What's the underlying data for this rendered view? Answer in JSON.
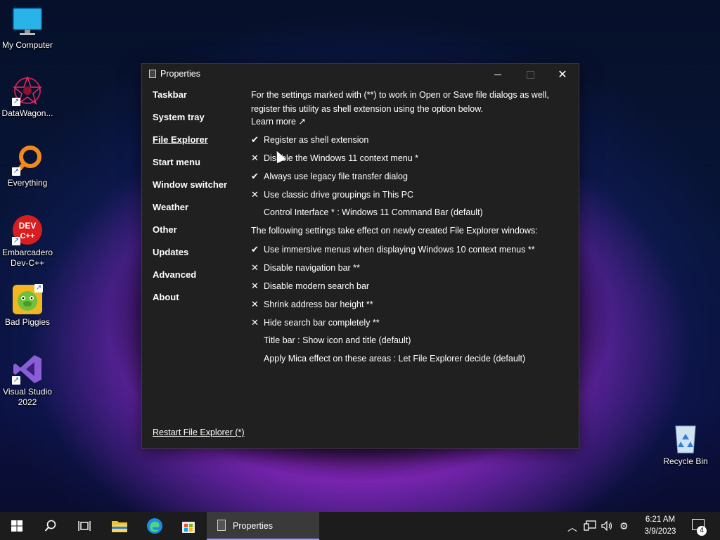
{
  "desktop": {
    "icons": [
      {
        "label": "My Computer"
      },
      {
        "label": "DataWagon..."
      },
      {
        "label": "Everything"
      },
      {
        "label": "Embarcadero Dev-C++"
      },
      {
        "label": "Bad Piggies"
      },
      {
        "label": "Visual Studio 2022"
      },
      {
        "label": "Recycle Bin"
      }
    ]
  },
  "window": {
    "title": "Properties",
    "nav": [
      "Taskbar",
      "System tray",
      "File Explorer",
      "Start menu",
      "Window switcher",
      "Weather",
      "Other",
      "Updates",
      "Advanced",
      "About"
    ],
    "active_nav": "File Explorer",
    "intro": "For the settings marked with (**) to work in Open or Save file dialogs as well, register this utility as shell extension using the option below.",
    "learn_more": "Learn more ↗",
    "options": [
      {
        "mark": "✔",
        "text": "Register as shell extension"
      },
      {
        "mark": "✕",
        "text": "Disable the Windows 11 context menu *"
      },
      {
        "mark": "✔",
        "text": "Always use legacy file transfer dialog"
      },
      {
        "mark": "✕",
        "text": "Use classic drive groupings in This PC"
      },
      {
        "mark": "",
        "text": "Control Interface * : Windows 11 Command Bar (default)"
      },
      {
        "mark": "",
        "text": "The following settings take effect on newly created File Explorer windows:"
      },
      {
        "mark": "✔",
        "text": "Use immersive menus when displaying Windows 10 context menus **"
      },
      {
        "mark": "✕",
        "text": "Disable navigation bar **"
      },
      {
        "mark": "✕",
        "text": "Disable modern search bar"
      },
      {
        "mark": "✕",
        "text": "Shrink address bar height **"
      },
      {
        "mark": "✕",
        "text": "Hide search bar completely **"
      },
      {
        "mark": "",
        "text": "Title bar : Show icon and title (default)"
      },
      {
        "mark": "",
        "text": "Apply Mica effect on these areas : Let File Explorer decide (default)"
      }
    ],
    "restart_link": "Restart File Explorer (*)"
  },
  "taskbar": {
    "active_app": "Properties",
    "time": "6:21 AM",
    "date": "3/9/2023",
    "notification_count": "4"
  },
  "colors": {
    "window_bg": "#202020",
    "taskbar_bg": "#1c1c1c",
    "accent": "#9a9aff"
  }
}
